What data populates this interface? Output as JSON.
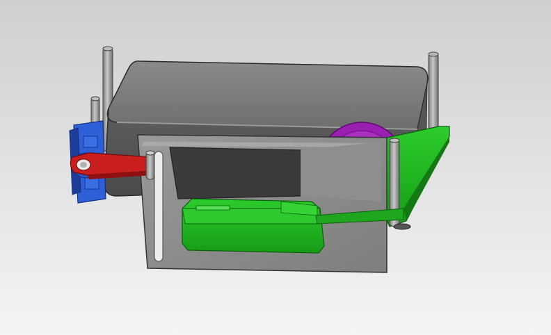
{
  "scene": {
    "colors": {
      "background_top": "#cfcfcf",
      "background_bottom": "#f4f4f4",
      "enclosure": "#6f6f6f",
      "enclosure_top": "#7d7d7d",
      "enclosure_edge": "#2a2a2a",
      "window_dark": "#3a3a3a",
      "plate": "#8a8a8a",
      "servo_body": "#2e5fd6",
      "servo_dark": "#1c3e99",
      "arm": "#c81e1e",
      "arm_dark": "#8e1010",
      "gear": "#9a1fb0",
      "gear_dark": "#6a0f7d",
      "bracket": "#22b522",
      "bracket_dark": "#137a13",
      "rod": "#9c9c9c",
      "rod_highlight": "#c8c8c8"
    }
  }
}
